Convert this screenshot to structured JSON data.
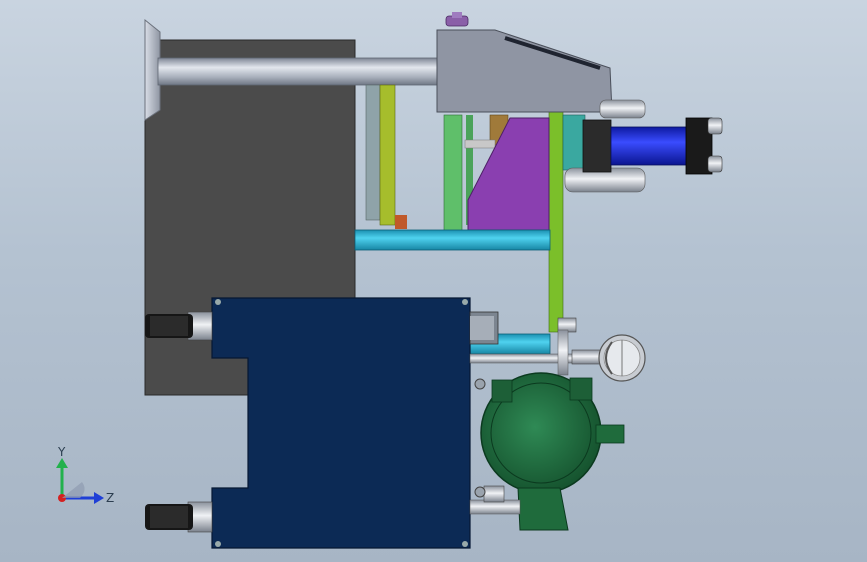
{
  "viewport": {
    "background_top": "#c9d4e0",
    "background_bottom": "#a7b5c5"
  },
  "triad": {
    "y_label": "Y",
    "z_label": "Z",
    "y_color": "#22b14c",
    "z_color": "#1f3fd6",
    "x_color": "#d42020"
  },
  "model_colors": {
    "back_plate": "#4a4a4a",
    "tank": "#0c2a55",
    "shaft": "#9ea6b4",
    "cylinder": "#2230d8",
    "purple_block": "#8a3fb0",
    "green_rod": "#7bbf2a",
    "cyan_pipe": "#27b5d6",
    "motor": "#1f6b3c",
    "upper_block": "#8f95a3"
  }
}
